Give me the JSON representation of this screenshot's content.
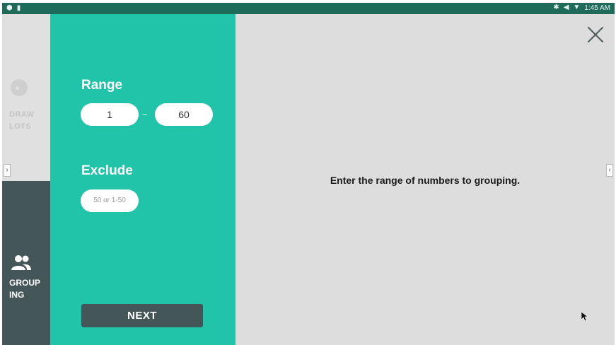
{
  "status_bar": {
    "time": "1:45 AM"
  },
  "sidebar": {
    "draw_lots_label_1": "DRAW",
    "draw_lots_label_2": "LOTS",
    "grouping_label_1": "GROUP",
    "grouping_label_2": "ING",
    "left_handle": "›",
    "right_handle": "‹"
  },
  "panel": {
    "range_heading": "Range",
    "range_from": "1",
    "range_separator": "~",
    "range_to": "60",
    "exclude_heading": "Exclude",
    "exclude_placeholder": "50 or 1-50",
    "next_label": "NEXT"
  },
  "main": {
    "instruction": "Enter the range of numbers to grouping."
  },
  "colors": {
    "status_bar": "#1e6b5a",
    "panel": "#22c4a9",
    "dark": "#455659",
    "main_bg": "#dddddd"
  }
}
